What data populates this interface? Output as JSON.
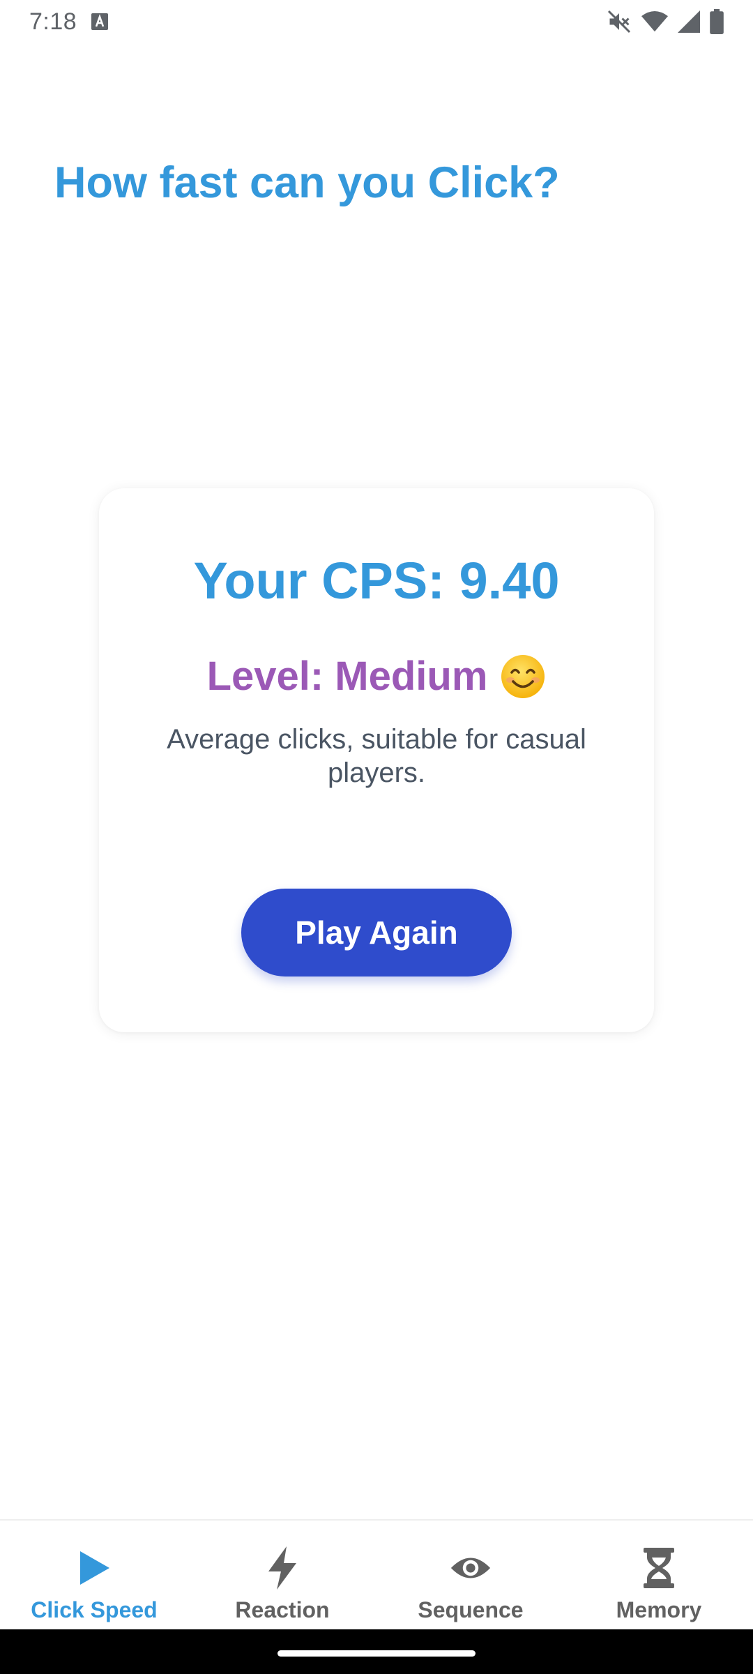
{
  "status_bar": {
    "time": "7:18",
    "icons": [
      "keyboard-a-icon",
      "mute-icon",
      "wifi-icon",
      "signal-icon",
      "battery-icon"
    ]
  },
  "page": {
    "title": "How fast can you Click?"
  },
  "result": {
    "cps_text": "Your CPS: 9.40",
    "level_text": "Level: Medium",
    "level_emoji": "smiling-face-icon",
    "description": "Average clicks, suitable for casual players.",
    "play_again_label": "Play Again"
  },
  "bottom_nav": {
    "items": [
      {
        "label": "Click Speed",
        "icon": "play-icon",
        "active": true
      },
      {
        "label": "Reaction",
        "icon": "lightning-icon",
        "active": false
      },
      {
        "label": "Sequence",
        "icon": "eye-icon",
        "active": false
      },
      {
        "label": "Memory",
        "icon": "hourglass-icon",
        "active": false
      }
    ]
  },
  "colors": {
    "accent": "#3498db",
    "level": "#9b59b6",
    "button": "#2f4ccc",
    "inactive_nav": "#616161"
  }
}
